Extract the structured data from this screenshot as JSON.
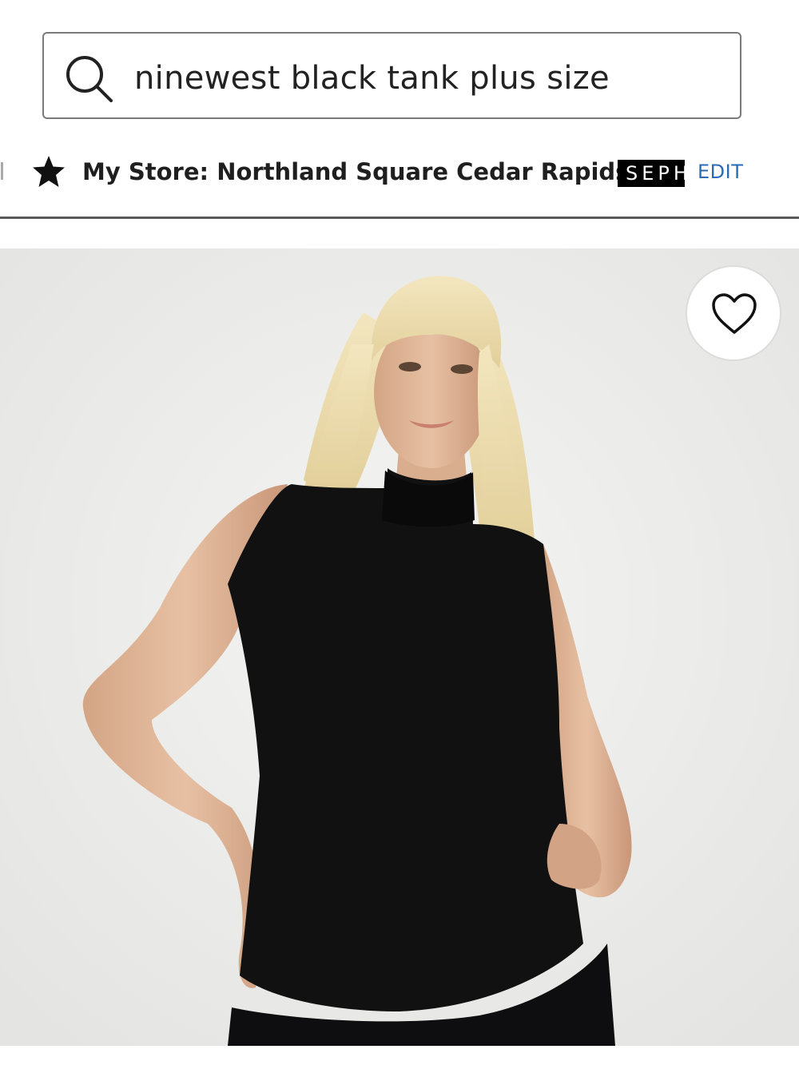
{
  "search": {
    "query": "ninewest black tank plus size",
    "icon": "search-icon"
  },
  "store_bar": {
    "store_label": "My Store: Northland Square Cedar Rapids",
    "star_icon": "star-icon",
    "brand_badge": "SEPH",
    "edit_label": "EDIT",
    "edit_color": "#2a6bb8"
  },
  "product": {
    "favorite_icon": "heart-icon"
  }
}
